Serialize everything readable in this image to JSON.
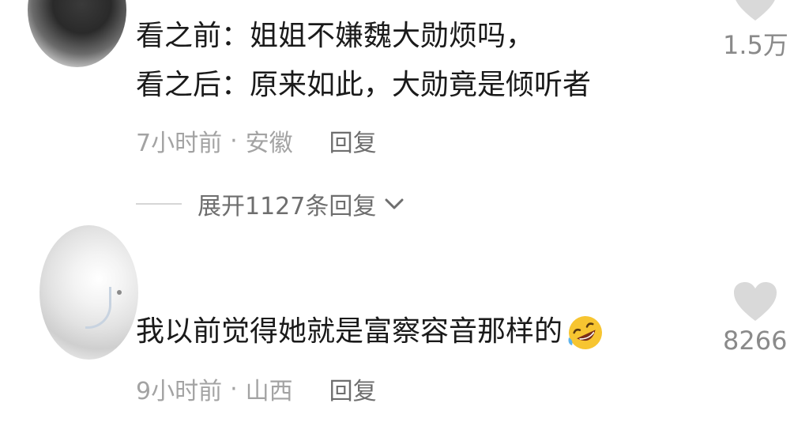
{
  "comments": [
    {
      "text_line1": "看之前：姐姐不嫌魏大勋烦吗，",
      "text_line2": "看之后：原来如此，大勋竟是倾听者",
      "time": "7小时前",
      "separator": "·",
      "location": "安徽",
      "reply": "回复",
      "likes": "1.5万",
      "expand_replies": "展开1127条回复"
    },
    {
      "text": "我以前觉得她就是富察容音那样的",
      "emoji": "rolling-on-floor-laughing-emoji",
      "time": "9小时前",
      "separator": "·",
      "location": "山西",
      "reply": "回复",
      "likes": "8266"
    }
  ],
  "colors": {
    "text": "#1a1a1a",
    "meta": "#a3a3a3",
    "link": "#6e6e6e",
    "like_icon": "#d9d9d9"
  }
}
